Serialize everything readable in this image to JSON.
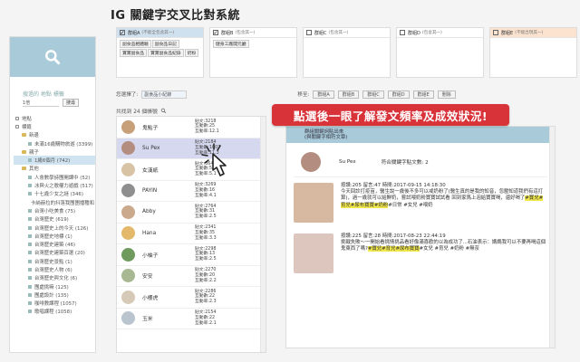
{
  "title": "IG 關鍵字交叉比對系統",
  "sidebar": {
    "search_hint": "搜過的 地點 標籤",
    "select_value": "1倍",
    "search_button": "搜尋",
    "tree": [
      {
        "label": "地點",
        "level": 0,
        "kind": "check"
      },
      {
        "label": "標籤",
        "level": 0,
        "kind": "check"
      },
      {
        "label": "新邊",
        "level": 1,
        "kind": "folder"
      },
      {
        "label": "未滿16歲購物旅遊 (3399)",
        "level": 2,
        "kind": "page"
      },
      {
        "label": "親子",
        "level": 1,
        "kind": "folder"
      },
      {
        "label": "1歲6個月 (742)",
        "level": 2,
        "kind": "page",
        "highlight": true
      },
      {
        "label": "其他",
        "level": 1,
        "kind": "folder"
      },
      {
        "label": "人會數學詩團開課中 (52)",
        "level": 2,
        "kind": "page"
      },
      {
        "label": "冰與火之歌權力遊戲 (517)",
        "level": 2,
        "kind": "page"
      },
      {
        "label": "十七歲少女之謎 (346)",
        "level": 2,
        "kind": "page"
      },
      {
        "label": "卡納赫拉的抖落我團團播種和 (354)",
        "level": 2,
        "kind": "page"
      },
      {
        "label": "台灣小吃美食 (75)",
        "level": 2,
        "kind": "page"
      },
      {
        "label": "台灣歷史 (619)",
        "level": 2,
        "kind": "page"
      },
      {
        "label": "台灣歷史上的今天 (126)",
        "level": 2,
        "kind": "page"
      },
      {
        "label": "台灣歷史地標 (1)",
        "level": 2,
        "kind": "page"
      },
      {
        "label": "台灣歷史建築 (46)",
        "level": 2,
        "kind": "page"
      },
      {
        "label": "台灣歷史建築百選 (20)",
        "level": 2,
        "kind": "page"
      },
      {
        "label": "台灣歷史景點 (1)",
        "level": 2,
        "kind": "page"
      },
      {
        "label": "台灣歷史人物 (6)",
        "level": 2,
        "kind": "page"
      },
      {
        "label": "台灣歷史與文化 (6)",
        "level": 2,
        "kind": "page"
      },
      {
        "label": "團處挑嘛 (125)",
        "level": 2,
        "kind": "page"
      },
      {
        "label": "團處設計 (135)",
        "level": 2,
        "kind": "page"
      },
      {
        "label": "咖啡教課程 (1057)",
        "level": 2,
        "kind": "page"
      },
      {
        "label": "歌唱課程 (1058)",
        "level": 2,
        "kind": "page"
      }
    ]
  },
  "groups": [
    {
      "name": "群組A",
      "sub": "(不能全包含其一)",
      "checked": true,
      "color": "#cfe0ee",
      "tags": [
        "副食品相體驗",
        "副食品日記",
        "寶寶副食品",
        "寶寶副食品紀錄",
        "奶粉"
      ]
    },
    {
      "name": "群組B",
      "sub": "(包含其一)",
      "checked": true,
      "color": "#ffffff",
      "tags": [
        "健身工廠開元廳"
      ]
    },
    {
      "name": "群組C",
      "sub": "(包含其一)",
      "checked": false,
      "color": "#ffffff",
      "tags": []
    },
    {
      "name": "群組D",
      "sub": "(包含其一)",
      "checked": false,
      "color": "#ffffff",
      "tags": []
    },
    {
      "name": "群組E",
      "sub": "(不能出現其一)",
      "checked": false,
      "color": "#fbe3d0",
      "tags": []
    }
  ],
  "toolbar": {
    "selected_label": "您選擇了:",
    "selected_value": "副食品小紀錄",
    "move_label": "移至:",
    "buttons": [
      "群組A",
      "群組B",
      "群組C",
      "群組D",
      "群組E",
      "刪除"
    ]
  },
  "count_label": "共找到 24 個帳號",
  "accounts": [
    {
      "name": "鬼點子",
      "posts": "貼文:3218",
      "likes": "互動數:25",
      "rate": "互動率:12.1",
      "color": "#c7a07a"
    },
    {
      "name": "Su Pex",
      "posts": "貼文:2184",
      "likes": "互動數:1007",
      "rate": "互動率:11.3",
      "color": "#b38d80",
      "active": true
    },
    {
      "name": "女漢紙",
      "posts": "貼文:364",
      "likes": "互動數:51",
      "rate": "互動率:5.1",
      "color": "#d8c3a5"
    },
    {
      "name": "PAYIN",
      "posts": "貼文:3269",
      "likes": "互動數:16",
      "rate": "互動率:4.1",
      "color": "#8f8f8f"
    },
    {
      "name": "Abby",
      "posts": "貼文:2764",
      "likes": "互動數:31",
      "rate": "互動率:2.5",
      "color": "#caa98c"
    },
    {
      "name": "Hana",
      "posts": "貼文:2341",
      "likes": "互動數:35",
      "rate": "互動率:3.3",
      "color": "#e3b86a"
    },
    {
      "name": "小柚子",
      "posts": "貼文:2298",
      "likes": "互動數:13",
      "rate": "互動率:2.5",
      "color": "#6f9a5e"
    },
    {
      "name": "安安",
      "posts": "貼文:2270",
      "likes": "互動數:20",
      "rate": "互動率:2.2",
      "color": "#a8b892"
    },
    {
      "name": "小櫻虎",
      "posts": "貼文:2286",
      "likes": "互動數:22",
      "rate": "互動率:2.3",
      "color": "#d7c9b8"
    },
    {
      "name": "玉米",
      "posts": "貼文:2154",
      "likes": "互動數:22",
      "rate": "互動率:2.1",
      "color": "#b9c4cf"
    }
  ],
  "banner": "點選後一眼了解發文頻率及成效狀況!",
  "detail": {
    "head_line1": "群組關鍵詞貼出來",
    "head_line2": "(與關鍵字相符文章)",
    "profile_name": "Su Pex",
    "profile_count": "符合關鍵字貼文數: 2",
    "posts": [
      {
        "meta": "按讚:205 留言:47 時間:2017-09-15 14:18:30",
        "text_before": "今天回診打疫苗，醫生說一歲後不多可以戒奶粉了(醫生真的是我的知音，忽壓知道我們有這打算)，過一歲就可以給鮮奶，嘗試喂奶粉寶寶試試看 回到家馬上泡給寶寶喝，還好喝了",
        "tags": [
          "#寶兒",
          "#育兒",
          "#尿布寶寶",
          "#奶粉"
        ],
        "text_after": "#日常 #女兒 #喂奶",
        "thumb": "#d7b8a0"
      },
      {
        "meta": "按讚:225 留言:28 時間:2017-08-23 22:44:19",
        "text_before": "挑戰失敗～一開始看挑情挑品看好像滿喜歡的以為成功了...石油表示：媽媽我可以不要再喝這個鬼東西了嗎?",
        "tags": [
          "#寶兒",
          "#育兒",
          "#尿布寶寶"
        ],
        "text_after": "#女兒 #育兒 #奶粉 #無奈",
        "thumb": "#dcc6bd"
      }
    ]
  }
}
